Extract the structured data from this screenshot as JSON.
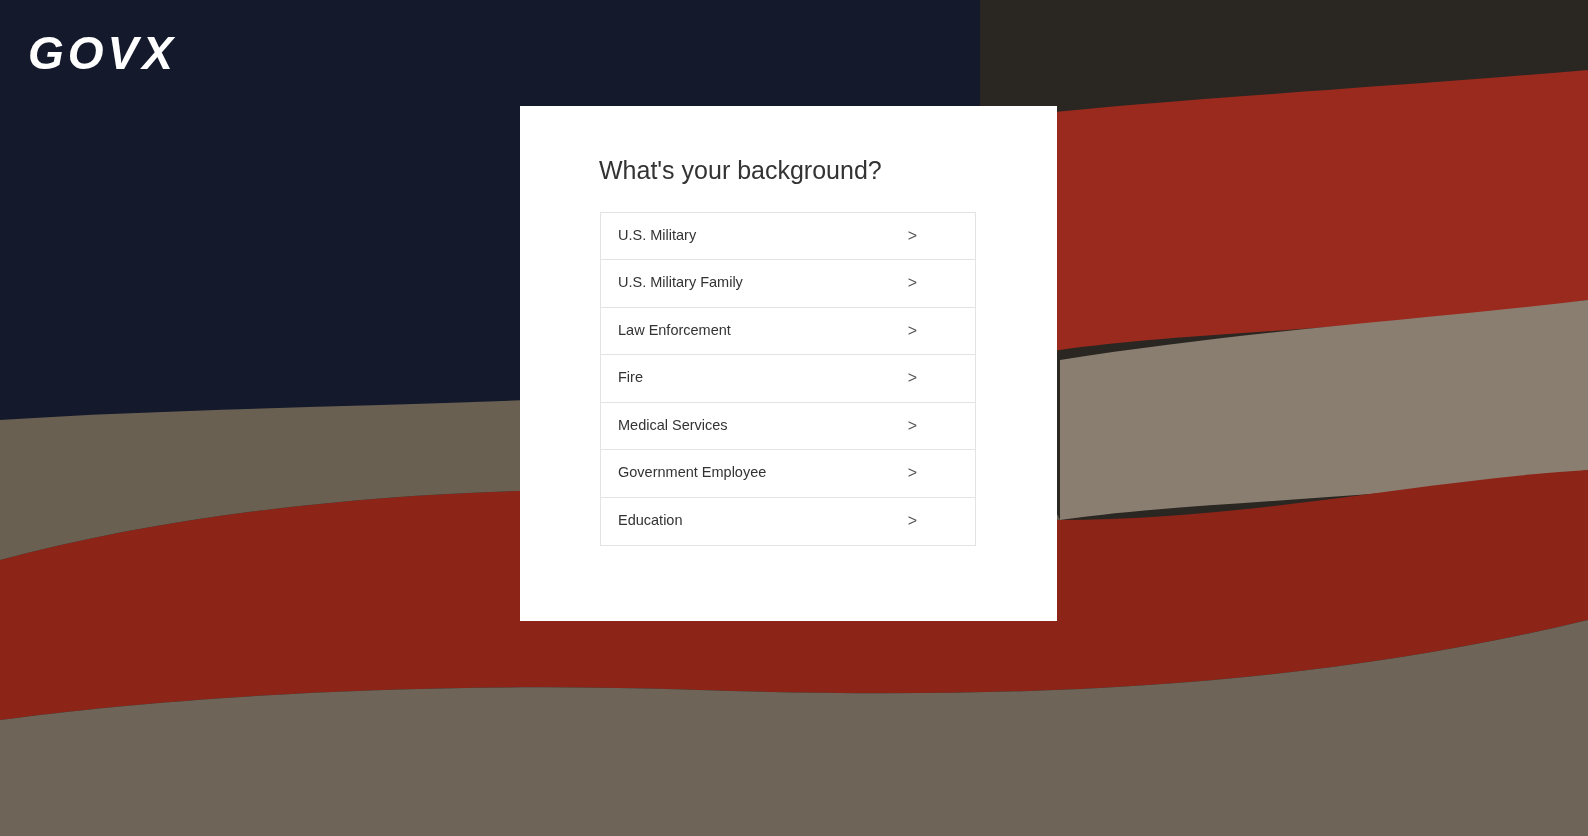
{
  "logo": "GOVX",
  "card": {
    "title": "What's your background?",
    "options": [
      {
        "label": "U.S. Military",
        "icon": ">"
      },
      {
        "label": "U.S. Military Family",
        "icon": ">"
      },
      {
        "label": "Law Enforcement",
        "icon": ">"
      },
      {
        "label": "Fire",
        "icon": ">"
      },
      {
        "label": "Medical Services",
        "icon": ">"
      },
      {
        "label": "Government Employee",
        "icon": ">"
      },
      {
        "label": "Education",
        "icon": ">"
      }
    ]
  }
}
